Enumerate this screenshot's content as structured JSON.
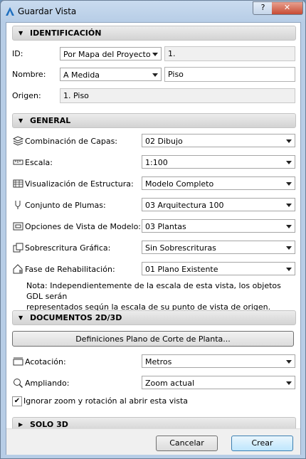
{
  "window": {
    "title": "Guardar Vista",
    "help_label": "?",
    "close_label": "✕"
  },
  "sections": {
    "identificacion": "IDENTIFICACIÓN",
    "general": "GENERAL",
    "documentos": "DOCUMENTOS 2D/3D",
    "solo3d": "SOLO 3D"
  },
  "identificacion": {
    "id_label": "ID:",
    "id_mode": "Por Mapa del Proyecto",
    "id_value": "1.",
    "nombre_label": "Nombre:",
    "nombre_mode": "A Medida",
    "nombre_value": "Piso",
    "origen_label": "Origen:",
    "origen_value": "1. Piso"
  },
  "general": {
    "capas_label": "Combinación de Capas:",
    "capas_value": "02 Dibujo",
    "escala_label": "Escala:",
    "escala_value": "1:100",
    "estructura_label": "Visualización de Estructura:",
    "estructura_value": "Modelo Completo",
    "plumas_label": "Conjunto de Plumas:",
    "plumas_value": "03 Arquitectura 100",
    "vista_modelo_label": "Opciones de Vista de Modelo:",
    "vista_modelo_value": "03 Plantas",
    "sobrescritura_label": "Sobrescritura Gráfica:",
    "sobrescritura_value": "Sin Sobrescrituras",
    "rehabilitacion_label": "Fase de Rehabilitación:",
    "rehabilitacion_value": "01 Plano Existente",
    "note_line1": "Nota: Independientemente de la escala de esta vista, los objetos GDL serán",
    "note_line2": "representados según la escala de su punto de vista de origen."
  },
  "documentos": {
    "corte_button": "Definiciones Plano de Corte de Planta...",
    "acotacion_label": "Acotación:",
    "acotacion_value": "Metros",
    "ampliando_label": "Ampliando:",
    "ampliando_value": "Zoom actual",
    "ignorar_label": "Ignorar zoom y rotación al abrir esta vista",
    "ignorar_checked": true
  },
  "footer": {
    "cancel_label": "Cancelar",
    "create_label": "Crear"
  },
  "colors": {
    "accent": "#3c7fb1",
    "window_frame": "#b7cde6",
    "close_button": "#c74b34"
  }
}
